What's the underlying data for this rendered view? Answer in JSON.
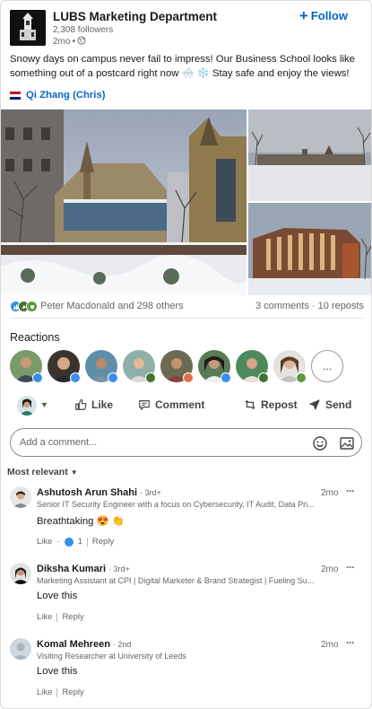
{
  "post": {
    "org_name": "LUBS Marketing Department",
    "followers": "2,308 followers",
    "time": "2mo",
    "meta_sep": "•",
    "follow_label": "Follow",
    "text": "Snowy days on campus never fail to impress! Our Business School looks like something out of a postcard right now 🌨️ ❄️ Stay safe and enjoy the views!",
    "mention": "Qi Zhang (Chris)"
  },
  "social": {
    "reactors": "Peter Macdonald and 298 others",
    "stats": "3 comments · 10 reposts",
    "reactions_title": "Reactions",
    "more_label": "..."
  },
  "actions": {
    "like": "Like",
    "comment": "Comment",
    "repost": "Repost",
    "send": "Send"
  },
  "comment_input": {
    "placeholder": "Add a comment..."
  },
  "sort_label": "Most relevant",
  "comments": [
    {
      "name": "Ashutosh Arun Shahi",
      "degree": "· 3rd+",
      "headline": "Senior IT Security Engineer with a focus on Cybersecurity, IT Audit, Data Pri...",
      "time": "2mo",
      "text": "Breathtaking 😍 👏",
      "like_label": "Like",
      "like_sep": "·",
      "like_count": "1",
      "reply_label": "Reply"
    },
    {
      "name": "Diksha Kumari",
      "degree": "· 3rd+",
      "headline": "Marketing Assistant at CPI | Digital Marketer & Brand Strategist | Fueling Su...",
      "time": "2mo",
      "text": "Love this",
      "like_label": "Like",
      "reply_label": "Reply"
    },
    {
      "name": "Komal Mehreen",
      "degree": "· 2nd",
      "headline": "Visiting Researcher at University of Leeds",
      "time": "2mo",
      "text": "Love this",
      "like_label": "Like",
      "reply_label": "Reply"
    }
  ],
  "icons": {
    "globe": "globe-icon",
    "like": "thumbs-up-icon",
    "comment": "speech-bubble-icon",
    "repost": "repost-arrows-icon",
    "send": "paper-plane-icon",
    "emoji": "smiley-icon",
    "image": "image-icon",
    "more": "ellipsis-icon"
  },
  "colors": {
    "accent": "#0a66c2",
    "like_blue": "#378fe9",
    "celebrate_green": "#44712e",
    "support_purple": "#715e86",
    "love_red": "#df704d"
  }
}
